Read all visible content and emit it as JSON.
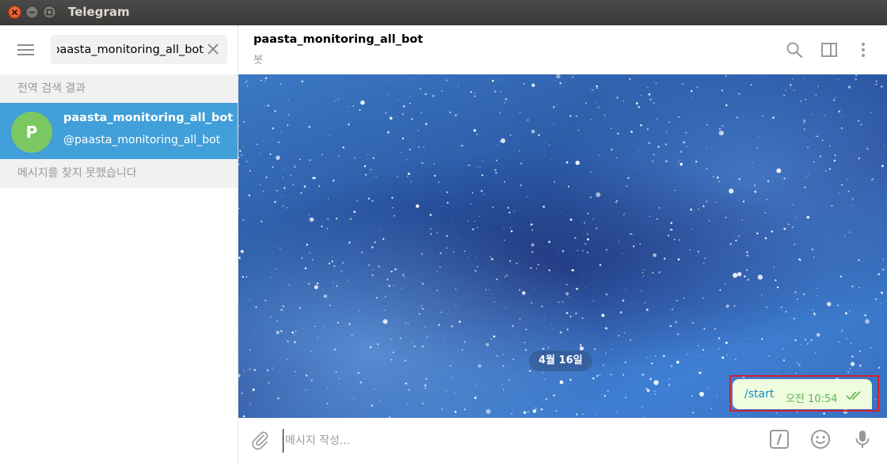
{
  "window": {
    "title": "Telegram"
  },
  "sidebar": {
    "search": {
      "value": "paasta_monitoring_all_bot"
    },
    "global_results_header": "전역 검색 결과",
    "result": {
      "avatar_letter": "P",
      "name": "paasta_monitoring_all_bot",
      "username": "@paasta_monitoring_all_bot"
    },
    "messages_header": "메시지를 찾지 못했습니다"
  },
  "chat": {
    "title": "paasta_monitoring_all_bot",
    "status": "봇",
    "date_divider": "4월 16일",
    "message": {
      "text": "/start",
      "time": "오전 10:54"
    }
  },
  "composer": {
    "placeholder": "메시지 작성..."
  },
  "colors": {
    "accent": "#419fd9",
    "avatar": "#7bc862",
    "bubble": "#effdde",
    "time": "#5fb257",
    "highlight": "#d2202f"
  },
  "icons": [
    "menu-icon",
    "close-icon",
    "search-icon",
    "sidebar-toggle-icon",
    "more-vert-icon",
    "attach-icon",
    "bot-command-icon",
    "emoji-icon",
    "mic-icon",
    "double-check-icon"
  ]
}
